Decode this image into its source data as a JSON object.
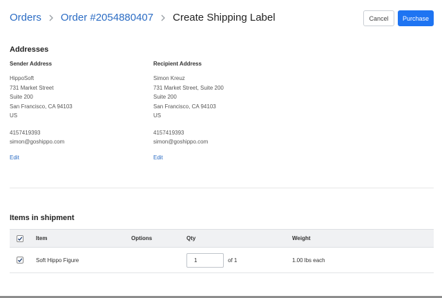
{
  "breadcrumb": {
    "orders": "Orders",
    "order": "Order #2054880407",
    "current": "Create Shipping Label"
  },
  "actions": {
    "cancel": "Cancel",
    "purchase": "Purchase"
  },
  "addresses": {
    "title": "Addresses",
    "sender": {
      "heading": "Sender Address",
      "name": "HippoSoft",
      "line1": "731 Market Street",
      "line2": "Suite 200",
      "city": "San Francisco, CA 94103",
      "country": "US",
      "phone": "4157419393",
      "email": "simon@goshippo.com",
      "edit": "Edit"
    },
    "recipient": {
      "heading": "Recipient Address",
      "name": "Simon Kreuz",
      "line1": "731 Market Street, Suite 200",
      "line2": "Suite 200",
      "city": "San Francisco, CA 94103",
      "country": "US",
      "phone": "4157419393",
      "email": "simon@goshippo.com",
      "edit": "Edit"
    }
  },
  "items": {
    "title": "Items in shipment",
    "columns": {
      "item": "Item",
      "options": "Options",
      "qty": "Qty",
      "weight": "Weight"
    },
    "rows": [
      {
        "name": "Soft Hippo Figure",
        "options": "",
        "qty": "1",
        "qty_of": "of 1",
        "weight": "1.00 lbs each"
      }
    ]
  },
  "colors": {
    "accent": "#1e74f2",
    "link": "#2b6cc4",
    "table_header_bg": "#f0f1f3"
  },
  "icons": {
    "breadcrumb_separator": "chevron-right-icon",
    "checkbox": "checkmark-icon"
  }
}
